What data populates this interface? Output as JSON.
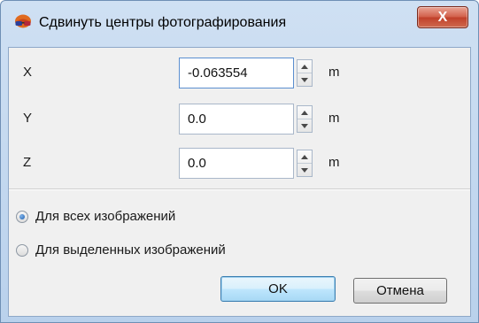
{
  "window": {
    "title": "Сдвинуть центры фотографирования",
    "close_label": "X"
  },
  "fields": [
    {
      "label": "X",
      "value": "-0.063554",
      "unit": "m"
    },
    {
      "label": "Y",
      "value": "0.0",
      "unit": "m"
    },
    {
      "label": "Z",
      "value": "0.0",
      "unit": "m"
    }
  ],
  "apply_to": {
    "options": [
      {
        "label": "Для всех изображений",
        "checked": true
      },
      {
        "label": "Для выделенных изображений",
        "checked": false
      }
    ]
  },
  "buttons": {
    "ok_label": "OK",
    "cancel_label": "Отмена"
  },
  "colors": {
    "title_bar": "#cfe0f3",
    "client_bg": "#f0f0f0",
    "close_button": "#c0402a",
    "default_button": "#bee6fd"
  },
  "icons": {
    "app": "3d-glasses-icon",
    "spin_up": "triangle-up-icon",
    "spin_down": "triangle-down-icon"
  }
}
